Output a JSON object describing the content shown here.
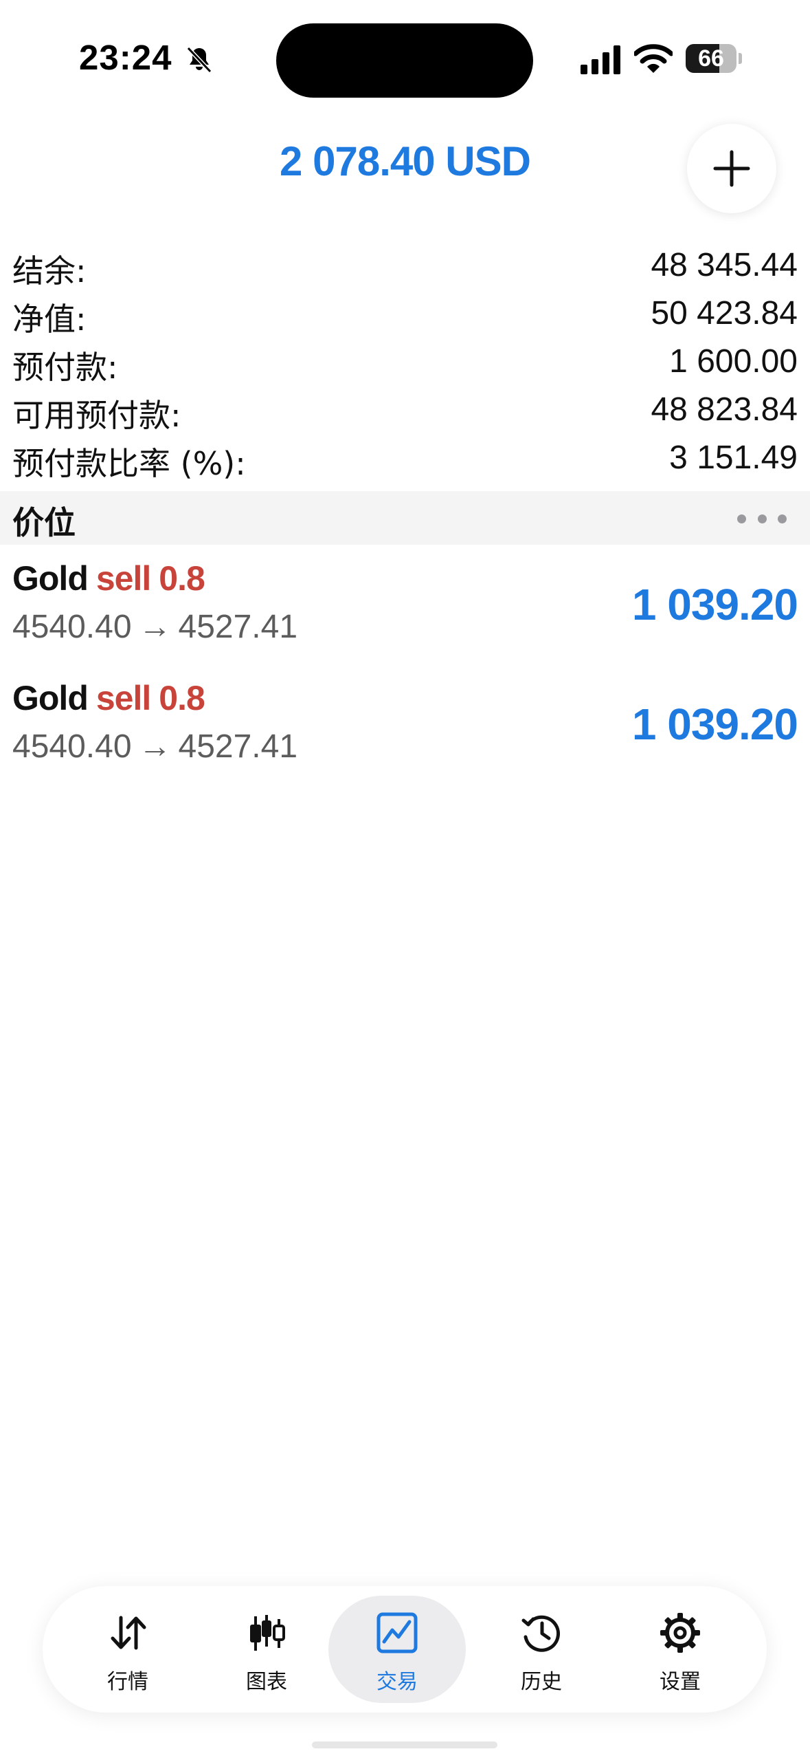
{
  "status_bar": {
    "time": "23:24",
    "battery_level": "66",
    "battery_fraction": 0.66
  },
  "header": {
    "total": "2 078.40 USD",
    "add_icon": "plus-icon"
  },
  "account_summary": [
    {
      "label": "结余:",
      "value": "48 345.44"
    },
    {
      "label": "净值:",
      "value": "50 423.84"
    },
    {
      "label": "预付款:",
      "value": "1 600.00"
    },
    {
      "label": "可用预付款:",
      "value": "48 823.84"
    },
    {
      "label": "预付款比率 (%):",
      "value": "3 151.49"
    }
  ],
  "positions_section": {
    "title": "价位",
    "more_icon": "more-icon"
  },
  "positions": [
    {
      "symbol": "Gold",
      "side": "sell",
      "volume": "0.8",
      "open_price": "4540.40",
      "arrow": "→",
      "current_price": "4527.41",
      "profit": "1 039.20"
    },
    {
      "symbol": "Gold",
      "side": "sell",
      "volume": "0.8",
      "open_price": "4540.40",
      "arrow": "→",
      "current_price": "4527.41",
      "profit": "1 039.20"
    }
  ],
  "tab_bar": {
    "tabs": [
      {
        "label": "行情",
        "icon": "quotes-arrows-icon",
        "active": false
      },
      {
        "label": "图表",
        "icon": "candlestick-icon",
        "active": false
      },
      {
        "label": "交易",
        "icon": "trade-chart-icon",
        "active": true
      },
      {
        "label": "历史",
        "icon": "history-icon",
        "active": false
      },
      {
        "label": "设置",
        "icon": "gear-icon",
        "active": false
      }
    ]
  },
  "colors": {
    "accent": "#1f7ae0",
    "sell": "#c8443a",
    "section_bg": "#f4f4f5"
  }
}
